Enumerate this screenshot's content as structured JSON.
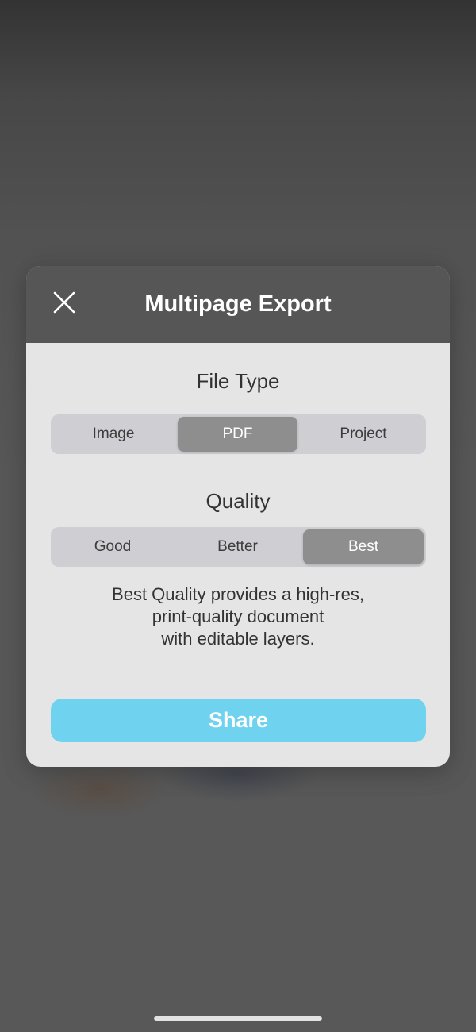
{
  "modal": {
    "title": "Multipage Export"
  },
  "file_type": {
    "title": "File Type",
    "options": [
      "Image",
      "PDF",
      "Project"
    ],
    "selected": "PDF"
  },
  "quality": {
    "title": "Quality",
    "options": [
      "Good",
      "Better",
      "Best"
    ],
    "selected": "Best",
    "description_lines": [
      "Best Quality provides a high-res,",
      "print-quality document",
      "with editable layers."
    ]
  },
  "actions": {
    "share_label": "Share"
  },
  "icons": {
    "close": "close-icon"
  },
  "colors": {
    "header": "#565656",
    "panel": "#e5e5e5",
    "segment_track": "#cfcfd3",
    "segment_selected": "#8e8e8e",
    "share_button": "#6fd3ef"
  }
}
